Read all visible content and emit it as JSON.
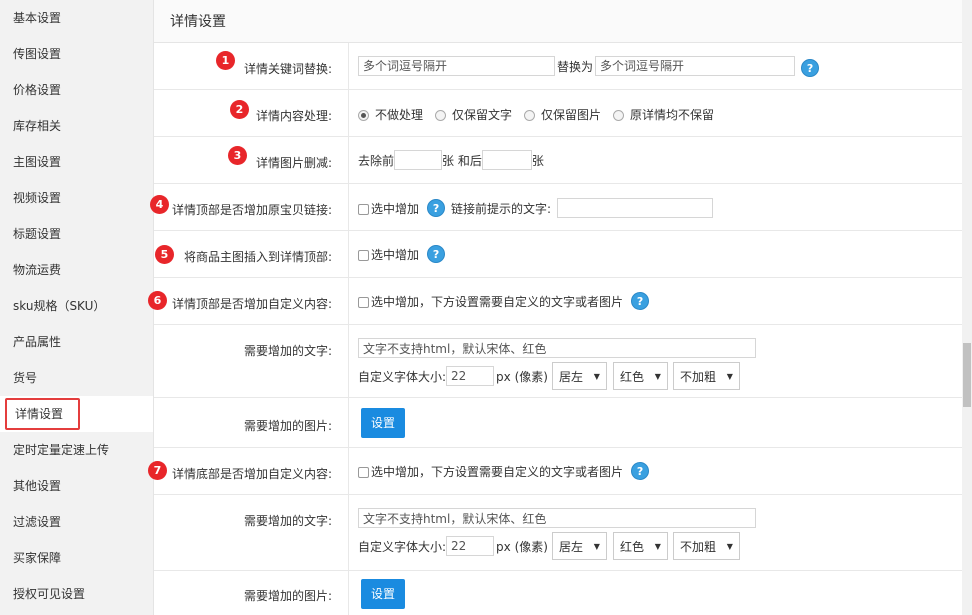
{
  "sidebar": {
    "items": [
      {
        "label": "基本设置"
      },
      {
        "label": "传图设置"
      },
      {
        "label": "价格设置"
      },
      {
        "label": "库存相关"
      },
      {
        "label": "主图设置"
      },
      {
        "label": "视频设置"
      },
      {
        "label": "标题设置"
      },
      {
        "label": "物流运费"
      },
      {
        "label": "sku规格（SKU）"
      },
      {
        "label": "产品属性"
      },
      {
        "label": "货号"
      },
      {
        "label": "详情设置"
      },
      {
        "label": "定时定量定速上传"
      },
      {
        "label": "其他设置"
      },
      {
        "label": "过滤设置"
      },
      {
        "label": "买家保障"
      },
      {
        "label": "授权可见设置"
      }
    ],
    "active_index": 11,
    "active_highlight_color": "#e43d3d"
  },
  "main": {
    "title": "详情设置",
    "rows": {
      "keyword": {
        "badge": "1",
        "label": "详情关键词替换:",
        "input1_placeholder": "多个词逗号隔开",
        "replace_text": "替换为",
        "input2_placeholder": "多个词逗号隔开",
        "help": "?"
      },
      "content": {
        "badge": "2",
        "label": "详情内容处理:",
        "options": [
          "不做处理",
          "仅保留文字",
          "仅保留图片",
          "原详情均不保留"
        ],
        "selected": 0
      },
      "images": {
        "badge": "3",
        "label": "详情图片删减:",
        "prefix": "去除前",
        "middle": "张 和后",
        "suffix": "张"
      },
      "link": {
        "badge": "4",
        "label": "详情顶部是否增加原宝贝链接:",
        "check_label": "选中增加",
        "help": "?",
        "hint_label": "链接前提示的文字:"
      },
      "insert_main": {
        "badge": "5",
        "label": "将商品主图插入到详情顶部:",
        "check_label": "选中增加",
        "help": "?"
      },
      "top_custom": {
        "badge": "6",
        "label": "详情顶部是否增加自定义内容:",
        "check_label": "选中增加，下方设置需要自定义的文字或者图片",
        "help": "?"
      },
      "top_text": {
        "label": "需要增加的文字:",
        "text_value": "文字不支持html，默认宋体、红色",
        "size_label": "自定义字体大小:",
        "size_value": "22",
        "unit": "px (像素)",
        "align": "居左",
        "color": "红色",
        "bold": "不加粗"
      },
      "top_image": {
        "label": "需要增加的图片:",
        "button": "设置"
      },
      "bottom_custom": {
        "badge": "7",
        "label": "详情底部是否增加自定义内容:",
        "check_label": "选中增加，下方设置需要自定义的文字或者图片",
        "help": "?"
      },
      "bottom_text": {
        "label": "需要增加的文字:",
        "text_value": "文字不支持html，默认宋体、红色",
        "size_label": "自定义字体大小:",
        "size_value": "22",
        "unit": "px (像素)",
        "align": "居左",
        "color": "红色",
        "bold": "不加粗"
      },
      "bottom_image": {
        "label": "需要增加的图片:",
        "button": "设置"
      }
    }
  },
  "colors": {
    "badge": "#e8262a",
    "help": "#3aa0e0",
    "button": "#1a8be0"
  }
}
